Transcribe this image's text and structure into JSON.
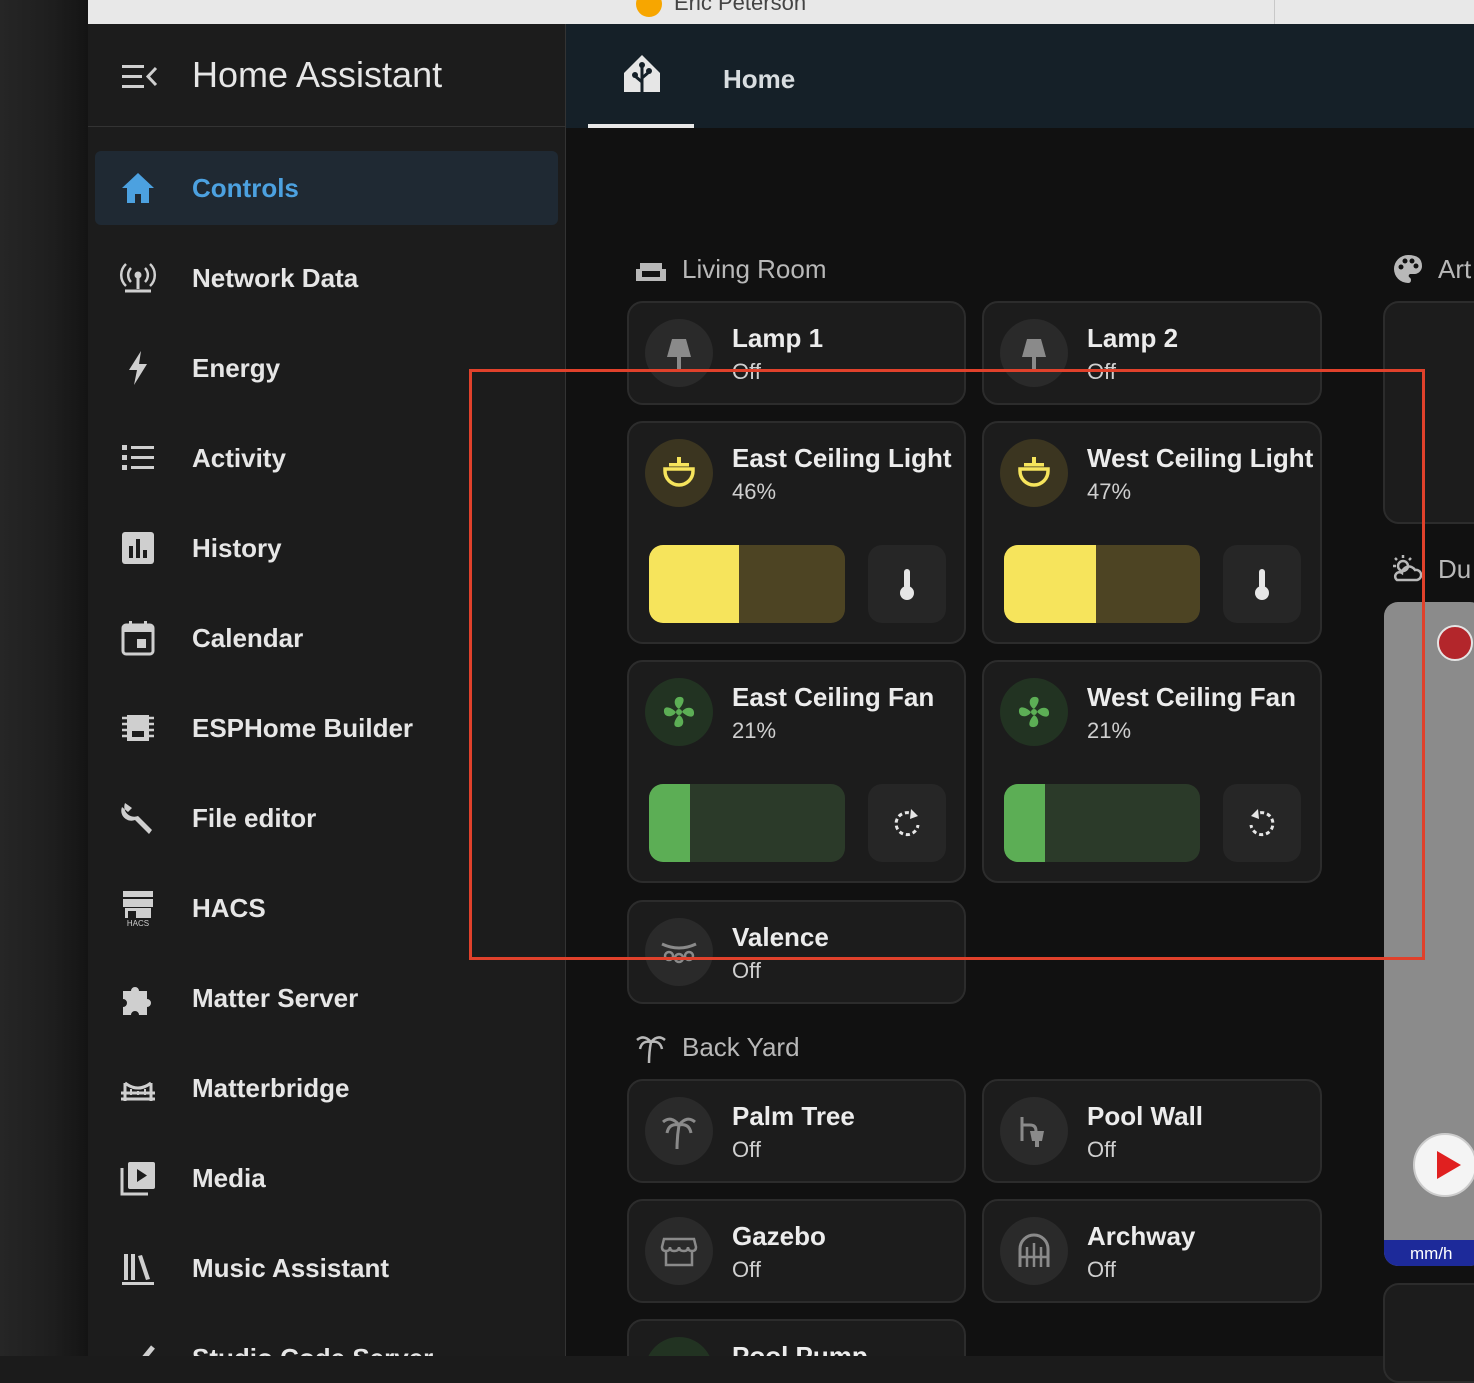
{
  "browser": {
    "account": "Eric Peterson"
  },
  "sidebar": {
    "title": "Home Assistant",
    "items": [
      {
        "label": "Controls",
        "icon": "home-icon",
        "active": true
      },
      {
        "label": "Network Data",
        "icon": "antenna-icon"
      },
      {
        "label": "Energy",
        "icon": "lightning-icon"
      },
      {
        "label": "Activity",
        "icon": "list-icon"
      },
      {
        "label": "History",
        "icon": "chart-box-icon"
      },
      {
        "label": "Calendar",
        "icon": "calendar-icon"
      },
      {
        "label": "ESPHome Builder",
        "icon": "chip-icon"
      },
      {
        "label": "File editor",
        "icon": "wrench-icon"
      },
      {
        "label": "HACS",
        "icon": "hacs-store-icon"
      },
      {
        "label": "Matter Server",
        "icon": "puzzle-icon"
      },
      {
        "label": "Matterbridge",
        "icon": "bridge-icon"
      },
      {
        "label": "Media",
        "icon": "play-box-icon"
      },
      {
        "label": "Music Assistant",
        "icon": "library-icon"
      },
      {
        "label": "Studio Code Server",
        "icon": "code-icon"
      }
    ]
  },
  "topbar": {
    "tab_label": "Home"
  },
  "sections": {
    "living_room": "Living Room",
    "back_yard": "Back Yard",
    "art": "Art",
    "du": "Du"
  },
  "cards": {
    "lamp1": {
      "name": "Lamp 1",
      "state": "Off"
    },
    "lamp2": {
      "name": "Lamp 2",
      "state": "Off"
    },
    "east_light": {
      "name": "East Ceiling Light",
      "state": "46%",
      "level": 0.46
    },
    "west_light": {
      "name": "West Ceiling Light",
      "state": "47%",
      "level": 0.47
    },
    "east_fan": {
      "name": "East Ceiling Fan",
      "state": "21%",
      "level": 0.21
    },
    "west_fan": {
      "name": "West Ceiling Fan",
      "state": "21%",
      "level": 0.21
    },
    "valence": {
      "name": "Valence",
      "state": "Off"
    },
    "palm_tree": {
      "name": "Palm Tree",
      "state": "Off"
    },
    "pool_wall": {
      "name": "Pool Wall",
      "state": "Off"
    },
    "gazebo": {
      "name": "Gazebo",
      "state": "Off"
    },
    "archway": {
      "name": "Archway",
      "state": "Off"
    },
    "pool_pump": {
      "name": "Pool Pump"
    }
  },
  "camera": {
    "unit": "mm/h"
  },
  "colors": {
    "accent": "#4ca1e0",
    "light_on": "#f6e45c",
    "light_track": "#4d4423",
    "fan_on": "#5cae55",
    "fan_track": "#2b3a29",
    "annotation": "#e0412b"
  }
}
